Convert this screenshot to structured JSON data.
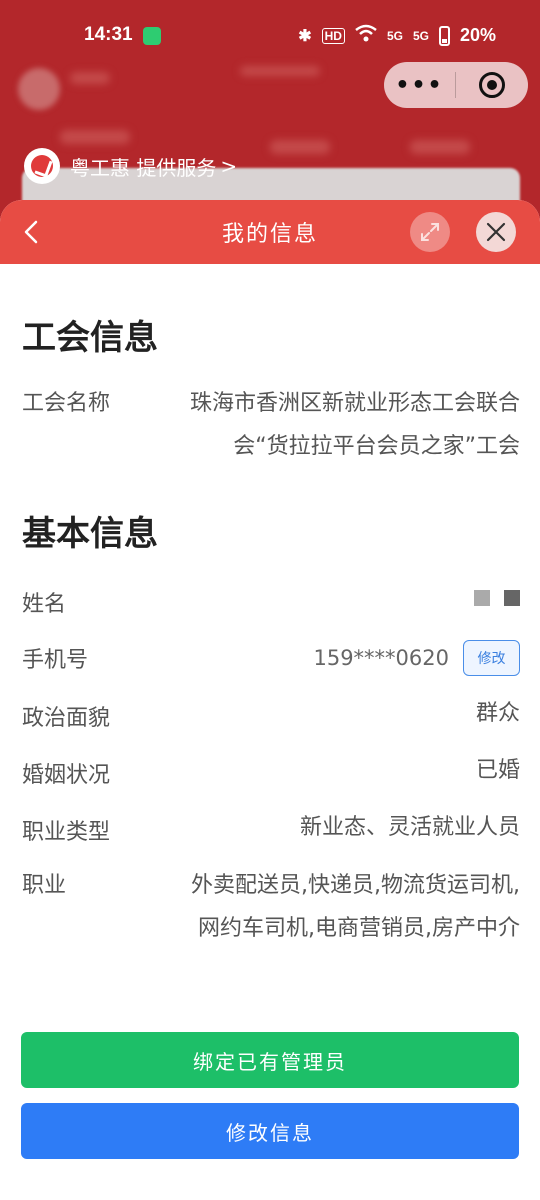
{
  "status_bar": {
    "time": "14:31",
    "hd_label": "HD",
    "signal1": "5G",
    "signal2": "5G",
    "battery": "20%"
  },
  "background_app": {
    "provider_text": "粤工惠 提供服务",
    "provider_chevron": ">"
  },
  "capsule": {
    "menu_dots": "•••"
  },
  "sheet": {
    "title": "我的信息"
  },
  "union_info": {
    "title": "工会信息",
    "rows": [
      {
        "label": "工会名称",
        "value_lines": [
          "珠海市香洲区新就业形态工会联合",
          "会“货拉拉平台会员之家”工会"
        ]
      }
    ]
  },
  "basic_info": {
    "title": "基本信息",
    "name": {
      "label": "姓名"
    },
    "phone": {
      "label": "手机号",
      "value": "159****0620",
      "edit_label": "修改"
    },
    "political": {
      "label": "政治面貌",
      "value": "群众"
    },
    "marital": {
      "label": "婚姻状况",
      "value": "已婚"
    },
    "job_type": {
      "label": "职业类型",
      "value": "新业态、灵活就业人员"
    },
    "occupation": {
      "label": "职业",
      "value_lines": [
        "外卖配送员,快递员,物流货运司机,",
        "网约车司机,电商营销员,房产中介"
      ]
    }
  },
  "buttons": {
    "bind_admin": "绑定已有管理员",
    "edit_info": "修改信息"
  },
  "colors": {
    "header_red": "#e74c44",
    "green": "#1dbf68",
    "blue": "#2e7cf6"
  }
}
